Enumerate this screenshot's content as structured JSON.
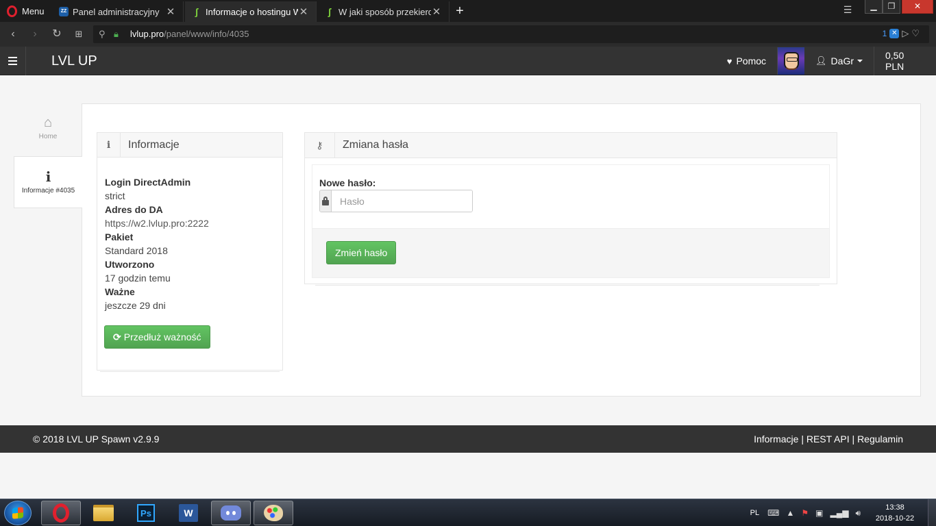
{
  "browser": {
    "menu_label": "Menu",
    "tabs": [
      {
        "title": "Panel administracyjny",
        "favicon": "panel-favicon"
      },
      {
        "title": "Informacje o hostingu WWW",
        "favicon": "leaf-favicon"
      },
      {
        "title": "W jaki sposób przekierować",
        "favicon": "leaf-favicon"
      }
    ],
    "url_host": "lvlup.pro",
    "url_path": "/panel/www/info/4035",
    "adblock_count": "1"
  },
  "navbar": {
    "brand": "LVL UP",
    "help_label": "Pomoc",
    "user_label": "DaGr",
    "balance": "0,50 PLN"
  },
  "sidebar": {
    "home_label": "Home",
    "info_label": "Informacje #4035"
  },
  "info_panel": {
    "title": "Informacje",
    "fields": [
      {
        "label": "Login DirectAdmin",
        "value": "strict"
      },
      {
        "label": "Adres do DA",
        "value": "https://w2.lvlup.pro:2222"
      },
      {
        "label": "Pakiet",
        "value": "Standard 2018"
      },
      {
        "label": "Utworzono",
        "value": "17 godzin temu"
      },
      {
        "label": "Ważne",
        "value": "jeszcze 29 dni"
      }
    ],
    "extend_button": "Przedłuż ważność"
  },
  "password_panel": {
    "title": "Zmiana hasła",
    "field_label": "Nowe hasło:",
    "placeholder": "Hasło",
    "submit_button": "Zmień hasło"
  },
  "footer": {
    "copyright": "© 2018 LVL UP Spawn v2.9.9",
    "links": [
      "Informacje",
      "REST API",
      "Regulamin"
    ],
    "separator": " | "
  },
  "taskbar": {
    "language": "PL",
    "time": "13:38",
    "date": "2018-10-22"
  },
  "colors": {
    "navbar": "#333333",
    "button_green": "#5cb85c",
    "page_bg": "#f5f5f5"
  }
}
